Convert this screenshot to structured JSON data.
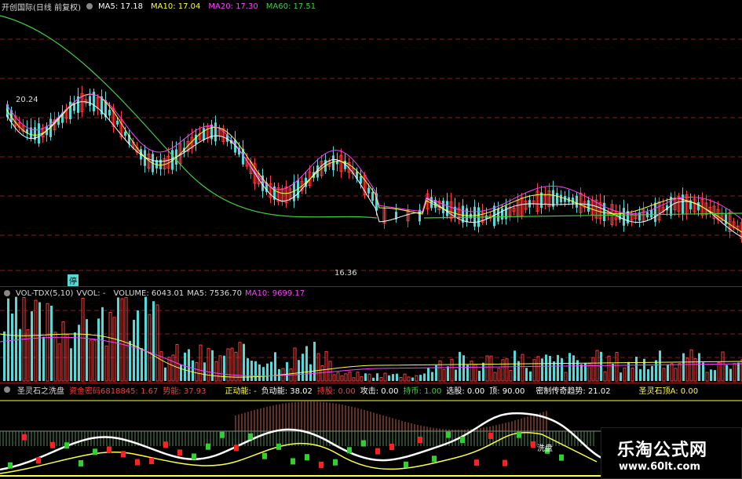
{
  "price_header": {
    "title": "开创国际(日线 前复权)",
    "ma5": "MA5: 17.18",
    "ma10": "MA10: 17.04",
    "ma20": "MA20: 17.30",
    "ma60": "MA60: 17.51"
  },
  "price_labels": {
    "high": "20.24",
    "low": "16.36",
    "stop": "停"
  },
  "vol_header": {
    "name": "VOL-TDX(5,10)",
    "vvol": "VVOL: -",
    "volume": "VOLUME: 6043.01",
    "ma5": "MA5: 7536.70",
    "ma10": "MA10: 9699.17"
  },
  "ind_header": {
    "name": "圣灵石之洗盘",
    "fund": "资金密码6818845: 1.67",
    "mom": "势能: 37.93",
    "pos": "正动能: -",
    "neg": "负动能: 38.02",
    "hold": "持股: 0.00",
    "attack": "攻击: 0.00",
    "holdcoin": "持币: 1.00",
    "pick": "选股: 0.00",
    "top": "顶: 90.00",
    "trend": "密制传奇趋势: 21.02",
    "stone": "圣灵石顶A: 0.00"
  },
  "ind_label": "洗盘",
  "colors": {
    "up": "#ff3c3c",
    "down": "#54d8d8",
    "ma5": "#ffffff",
    "ma10": "#ffff40",
    "ma20": "#ff40ff",
    "ma60": "#40d040",
    "grid": "#8b1a1a"
  },
  "watermark": {
    "title": "乐淘公式网",
    "url": "www.60lt.com"
  }
}
